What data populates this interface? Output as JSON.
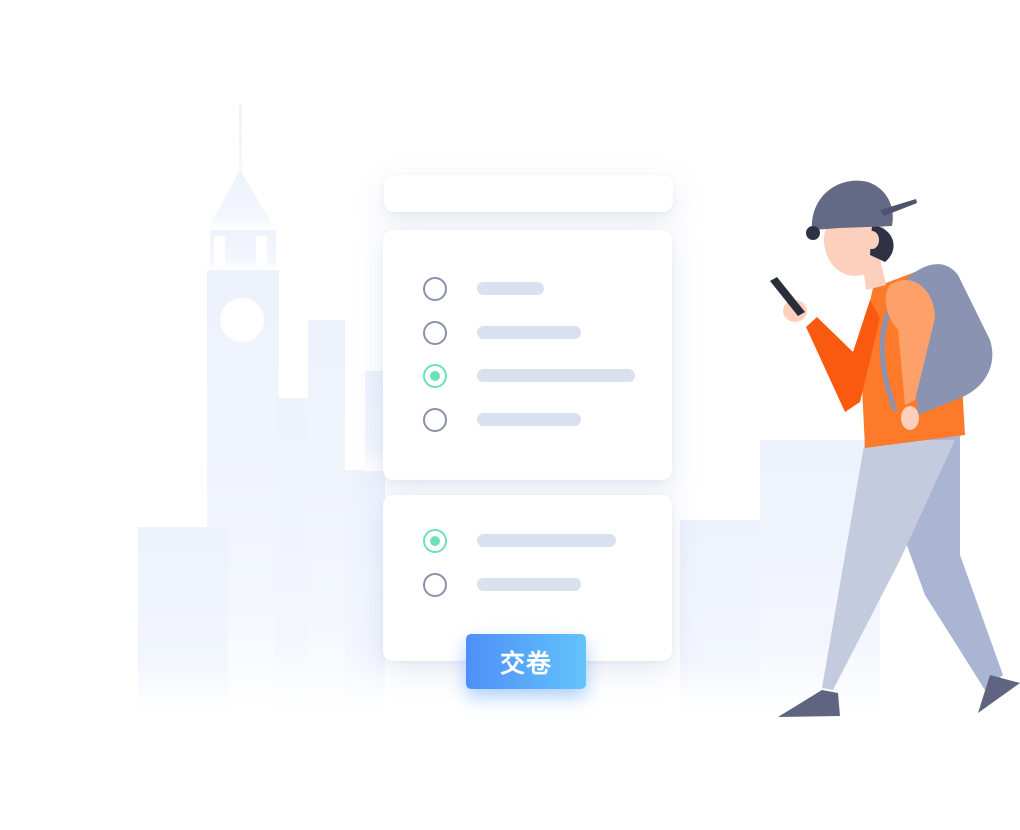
{
  "survey": {
    "options_card_1": [
      {
        "selected": false
      },
      {
        "selected": false
      },
      {
        "selected": true
      },
      {
        "selected": false
      }
    ],
    "options_card_2": [
      {
        "selected": true
      },
      {
        "selected": false
      }
    ]
  },
  "submit_button": {
    "label": "交卷"
  },
  "colors": {
    "accent_green": "#6ee0b9",
    "radio_border": "#8a91ab",
    "placeholder_bar": "#d9e1ef",
    "button_gradient_start": "#4e8ff8",
    "button_gradient_end": "#63c3fb",
    "shirt_orange": "#fd7a2b",
    "cap_gray": "#646a86",
    "pants_light": "#c5cbdf",
    "skyline_tint": "#eef3fe"
  },
  "illustration": {
    "background": "city-skyline",
    "figure": "person-with-backpack-looking-at-phone"
  }
}
